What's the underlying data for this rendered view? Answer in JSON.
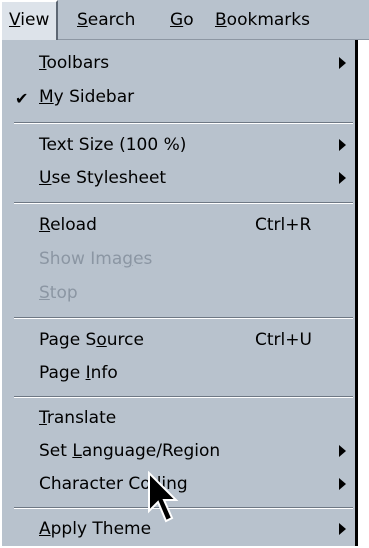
{
  "menubar": {
    "items": [
      {
        "first": "V",
        "rest": "iew"
      },
      {
        "first": "S",
        "rest": "earch"
      },
      {
        "first": "G",
        "rest": "o"
      },
      {
        "first": "B",
        "rest": "ookmarks"
      }
    ]
  },
  "view_menu": {
    "toolbars": {
      "pre": "",
      "u": "T",
      "post": "oolbars"
    },
    "my_sidebar": {
      "pre": "",
      "u": "M",
      "post": "y Sidebar",
      "check": "✔"
    },
    "text_size": {
      "pre": "Text Size (100 %)",
      "u": "",
      "post": ""
    },
    "use_stylesheet": {
      "pre": "",
      "u": "U",
      "post": "se Stylesheet"
    },
    "reload": {
      "pre": "",
      "u": "R",
      "post": "eload",
      "shortcut": "Ctrl+R"
    },
    "show_images": {
      "pre": "Show Ima",
      "u": "g",
      "post": "es"
    },
    "stop": {
      "pre": "",
      "u": "S",
      "post": "top"
    },
    "page_source": {
      "pre": "Page S",
      "u": "o",
      "post": "urce",
      "shortcut": "Ctrl+U"
    },
    "page_info": {
      "pre": "Page ",
      "u": "I",
      "post": "nfo"
    },
    "translate": {
      "pre": "",
      "u": "T",
      "post": "ranslate"
    },
    "set_language": {
      "pre": "Set ",
      "u": "L",
      "post": "anguage/Region"
    },
    "character_coding": {
      "pre": "Character Coding",
      "u": "",
      "post": ""
    },
    "apply_theme": {
      "pre": "",
      "u": "A",
      "post": "pply Theme"
    }
  }
}
